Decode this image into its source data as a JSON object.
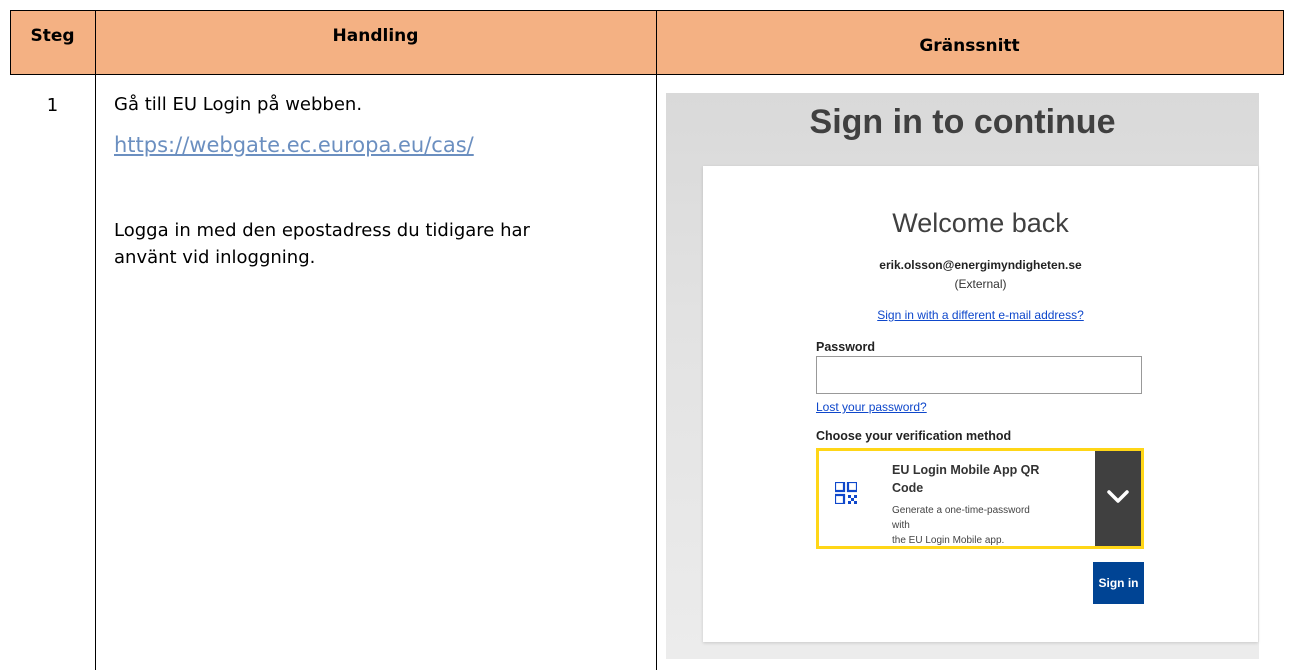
{
  "table": {
    "headers": {
      "step": "Steg",
      "action": "Handling",
      "interface": "Gränssnitt"
    },
    "rows": [
      {
        "step": "1",
        "action_line1": "Gå till EU Login på webben.",
        "action_link": "https://webgate.ec.europa.eu/cas/",
        "action_line2": "Logga in med den epostadress du tidigare har",
        "action_line3": "använt vid inloggning."
      }
    ]
  },
  "screenshot": {
    "title": "Sign in to continue",
    "welcome": "Welcome back",
    "email": "erik.olsson@energimyndigheten.se",
    "external": "(External)",
    "different_email_link": "Sign in with a different e-mail address?",
    "password_label": "Password",
    "password_value": "",
    "lost_password_link": "Lost your password?",
    "choose_method_label": "Choose your verification method",
    "method": {
      "title_line1": "EU Login Mobile App QR",
      "title_line2": "Code",
      "desc_line1": "Generate a one-time-password with",
      "desc_line2": "the EU Login Mobile app."
    },
    "signin_button": "Sign in",
    "colors": {
      "header_bg": "#f4b183",
      "accent_yellow": "#ffd617",
      "button_blue": "#004494",
      "link_blue": "#0e47cb"
    }
  }
}
